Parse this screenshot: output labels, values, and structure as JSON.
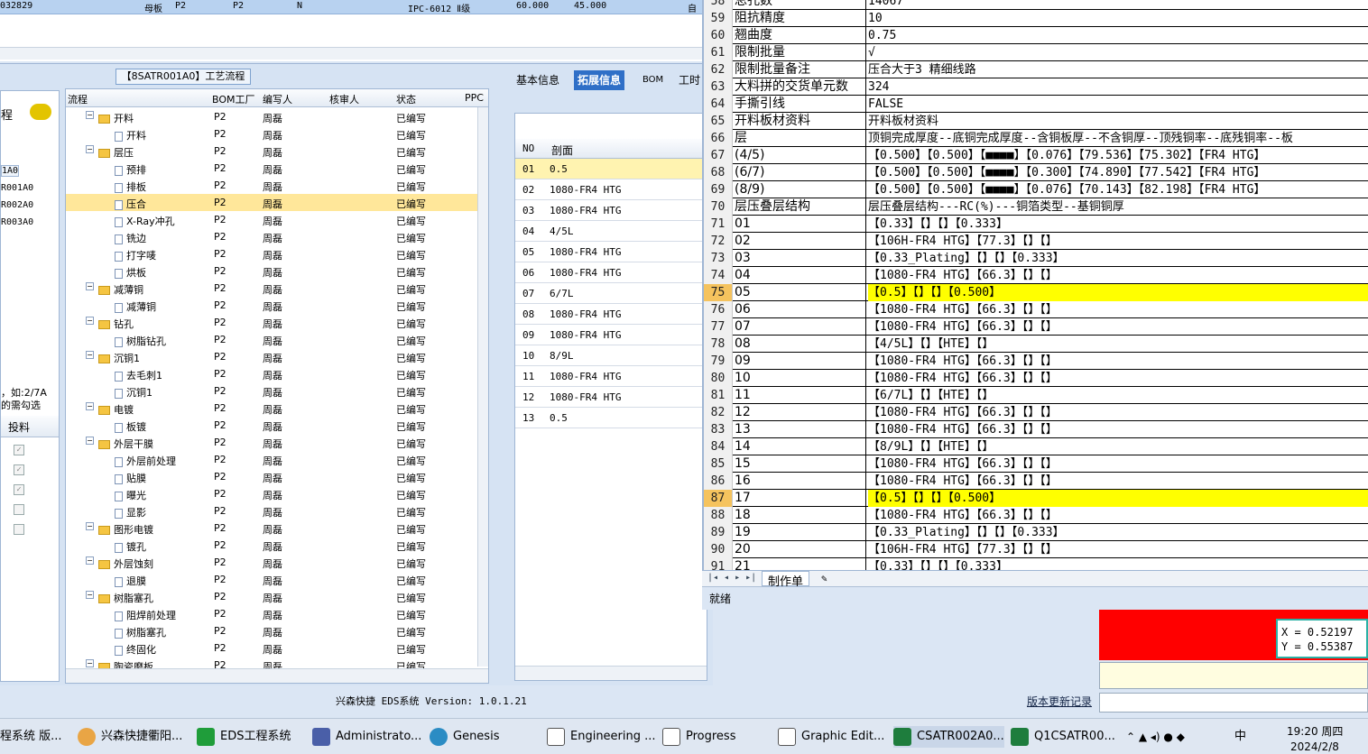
{
  "top_row": {
    "id": "032829",
    "type": "母板",
    "a": "P2",
    "b": "P2",
    "c": "N",
    "grade": "IPC-6012 Ⅱ级",
    "v1": "60.000",
    "v2": "45.000",
    "extra": "自"
  },
  "process": {
    "title": "【8SATR001A0】工艺流程",
    "side_label": "程",
    "side_items": [
      "1A0",
      "R001A0",
      "R002A0",
      "R003A0"
    ],
    "side_hint1": "，如:2/7A",
    "side_hint2": "的需勾选",
    "side_col": "投料",
    "headers": [
      "流程",
      "BOM工厂",
      "编写人",
      "核审人",
      "状态",
      "PPC"
    ],
    "rows": [
      {
        "name": "开料",
        "level": 1,
        "bom": "P2",
        "author": "周磊",
        "status": "已编写"
      },
      {
        "name": "开料",
        "level": 2,
        "bom": "P2",
        "author": "周磊",
        "status": "已编写"
      },
      {
        "name": "层压",
        "level": 1,
        "bom": "P2",
        "author": "周磊",
        "status": "已编写"
      },
      {
        "name": "预排",
        "level": 2,
        "bom": "P2",
        "author": "周磊",
        "status": "已编写"
      },
      {
        "name": "排板",
        "level": 2,
        "bom": "P2",
        "author": "周磊",
        "status": "已编写"
      },
      {
        "name": "压合",
        "level": 2,
        "bom": "P2",
        "author": "周磊",
        "status": "已编写",
        "selected": true
      },
      {
        "name": "X-Ray冲孔",
        "level": 2,
        "bom": "P2",
        "author": "周磊",
        "status": "已编写"
      },
      {
        "name": "铣边",
        "level": 2,
        "bom": "P2",
        "author": "周磊",
        "status": "已编写"
      },
      {
        "name": "打字唛",
        "level": 2,
        "bom": "P2",
        "author": "周磊",
        "status": "已编写"
      },
      {
        "name": "烘板",
        "level": 2,
        "bom": "P2",
        "author": "周磊",
        "status": "已编写"
      },
      {
        "name": "减薄铜",
        "level": 1,
        "bom": "P2",
        "author": "周磊",
        "status": "已编写"
      },
      {
        "name": "减薄铜",
        "level": 2,
        "bom": "P2",
        "author": "周磊",
        "status": "已编写"
      },
      {
        "name": "钻孔",
        "level": 1,
        "bom": "P2",
        "author": "周磊",
        "status": "已编写"
      },
      {
        "name": "树脂钻孔",
        "level": 2,
        "bom": "P2",
        "author": "周磊",
        "status": "已编写"
      },
      {
        "name": "沉铜1",
        "level": 1,
        "bom": "P2",
        "author": "周磊",
        "status": "已编写"
      },
      {
        "name": "去毛刺1",
        "level": 2,
        "bom": "P2",
        "author": "周磊",
        "status": "已编写"
      },
      {
        "name": "沉铜1",
        "level": 2,
        "bom": "P2",
        "author": "周磊",
        "status": "已编写"
      },
      {
        "name": "电镀",
        "level": 1,
        "bom": "P2",
        "author": "周磊",
        "status": "已编写"
      },
      {
        "name": "板镀",
        "level": 2,
        "bom": "P2",
        "author": "周磊",
        "status": "已编写"
      },
      {
        "name": "外层干膜",
        "level": 1,
        "bom": "P2",
        "author": "周磊",
        "status": "已编写"
      },
      {
        "name": "外层前处理",
        "level": 2,
        "bom": "P2",
        "author": "周磊",
        "status": "已编写"
      },
      {
        "name": "贴膜",
        "level": 2,
        "bom": "P2",
        "author": "周磊",
        "status": "已编写"
      },
      {
        "name": "曝光",
        "level": 2,
        "bom": "P2",
        "author": "周磊",
        "status": "已编写"
      },
      {
        "name": "显影",
        "level": 2,
        "bom": "P2",
        "author": "周磊",
        "status": "已编写"
      },
      {
        "name": "图形电镀",
        "level": 1,
        "bom": "P2",
        "author": "周磊",
        "status": "已编写"
      },
      {
        "name": "镀孔",
        "level": 2,
        "bom": "P2",
        "author": "周磊",
        "status": "已编写"
      },
      {
        "name": "外层蚀刻",
        "level": 1,
        "bom": "P2",
        "author": "周磊",
        "status": "已编写"
      },
      {
        "name": "退膜",
        "level": 2,
        "bom": "P2",
        "author": "周磊",
        "status": "已编写"
      },
      {
        "name": "树脂塞孔",
        "level": 1,
        "bom": "P2",
        "author": "周磊",
        "status": "已编写"
      },
      {
        "name": "阻焊前处理",
        "level": 2,
        "bom": "P2",
        "author": "周磊",
        "status": "已编写"
      },
      {
        "name": "树脂塞孔",
        "level": 2,
        "bom": "P2",
        "author": "周磊",
        "status": "已编写"
      },
      {
        "name": "终固化",
        "level": 2,
        "bom": "P2",
        "author": "周磊",
        "status": "已编写"
      },
      {
        "name": "陶瓷磨板",
        "level": 1,
        "bom": "P2",
        "author": "周磊",
        "status": "已编写"
      }
    ]
  },
  "tabs": [
    "基本信息",
    "拓展信息",
    "BOM",
    "工时"
  ],
  "section": {
    "headers": [
      "NO",
      "剖面"
    ],
    "rows": [
      [
        "01",
        "0.5"
      ],
      [
        "02",
        "1080-FR4 HTG"
      ],
      [
        "03",
        "1080-FR4 HTG"
      ],
      [
        "04",
        "4/5L"
      ],
      [
        "05",
        "1080-FR4 HTG"
      ],
      [
        "06",
        "1080-FR4 HTG"
      ],
      [
        "07",
        "6/7L"
      ],
      [
        "08",
        "1080-FR4 HTG"
      ],
      [
        "09",
        "1080-FR4 HTG"
      ],
      [
        "10",
        "8/9L"
      ],
      [
        "11",
        "1080-FR4 HTG"
      ],
      [
        "12",
        "1080-FR4 HTG"
      ],
      [
        "13",
        "0.5"
      ]
    ]
  },
  "sheet": {
    "rows": [
      [
        "58",
        "总孔数",
        "14067"
      ],
      [
        "59",
        "阻抗精度",
        "10"
      ],
      [
        "60",
        "翘曲度",
        "0.75"
      ],
      [
        "61",
        "限制批量",
        "√"
      ],
      [
        "62",
        "限制批量备注",
        "压合大于3  精细线路"
      ],
      [
        "63",
        "大料拼的交货单元数",
        "324"
      ],
      [
        "64",
        "手撕引线",
        "FALSE"
      ],
      [
        "65",
        "开料板材资料",
        "开料板材资料"
      ],
      [
        "66",
        "层",
        "顶铜完成厚度--底铜完成厚度--含铜板厚--不含铜厚--顶残铜率--底残铜率--板"
      ],
      [
        "67",
        "(4/5)",
        "【0.500】【0.500】【■■■■】【0.076】【79.536】【75.302】【FR4 HTG】"
      ],
      [
        "68",
        "(6/7)",
        "【0.500】【0.500】【■■■■】【0.300】【74.890】【77.542】【FR4 HTG】"
      ],
      [
        "69",
        "(8/9)",
        "【0.500】【0.500】【■■■■】【0.076】【70.143】【82.198】【FR4 HTG】"
      ],
      [
        "70",
        "层压叠层结构",
        "层压叠层结构---RC(%)---铜箔类型--基铜铜厚"
      ],
      [
        "71",
        "01",
        "【0.33】【】【】【0.333】"
      ],
      [
        "72",
        "02",
        "【106H-FR4 HTG】【77.3】【】【】"
      ],
      [
        "73",
        "03",
        "【0.33_Plating】【】【】【0.333】"
      ],
      [
        "74",
        "04",
        "【1080-FR4 HTG】【66.3】【】【】"
      ],
      [
        "75",
        "05",
        "【0.5】【】【】【0.500】",
        "hl"
      ],
      [
        "76",
        "06",
        "【1080-FR4 HTG】【66.3】【】【】"
      ],
      [
        "77",
        "07",
        "【1080-FR4 HTG】【66.3】【】【】"
      ],
      [
        "78",
        "08",
        "【4/5L】【】【HTE】【】"
      ],
      [
        "79",
        "09",
        "【1080-FR4 HTG】【66.3】【】【】"
      ],
      [
        "80",
        "10",
        "【1080-FR4 HTG】【66.3】【】【】"
      ],
      [
        "81",
        "11",
        "【6/7L】【】【HTE】【】"
      ],
      [
        "82",
        "12",
        "【1080-FR4 HTG】【66.3】【】【】"
      ],
      [
        "83",
        "13",
        "【1080-FR4 HTG】【66.3】【】【】"
      ],
      [
        "84",
        "14",
        "【8/9L】【】【HTE】【】"
      ],
      [
        "85",
        "15",
        "【1080-FR4 HTG】【66.3】【】【】"
      ],
      [
        "86",
        "16",
        "【1080-FR4 HTG】【66.3】【】【】"
      ],
      [
        "87",
        "17",
        "【0.5】【】【】【0.500】",
        "hl"
      ],
      [
        "88",
        "18",
        "【1080-FR4 HTG】【66.3】【】【】"
      ],
      [
        "89",
        "19",
        "【0.33_Plating】【】【】【0.333】"
      ],
      [
        "90",
        "20",
        "【106H-FR4 HTG】【77.3】【】【】"
      ],
      [
        "91",
        "21",
        "【0.33】【】【】【0.333】"
      ]
    ],
    "sheet_tab": "制作单",
    "status": "就绪"
  },
  "coords": {
    "x": "X = 0.52197",
    "y": "Y = 0.55387"
  },
  "footer": {
    "title": "兴森快捷 EDS系统 Version: 1.0.1.21",
    "link": "版本更新记录"
  },
  "taskbar": {
    "items": [
      "程系统  版...",
      "兴森快捷衢阳...",
      "EDS工程系统",
      "Administrato...",
      "Genesis",
      "Engineering ...",
      "Progress",
      "Graphic Edit...",
      "CSATR002A0...",
      "Q1CSATR00..."
    ],
    "ime": "中",
    "time": "19:20 周四",
    "date": "2024/2/8"
  },
  "colors": {
    "highlight": "#ffff00",
    "selected": "#ffe79a",
    "tab_active": "#2f6fc7"
  }
}
